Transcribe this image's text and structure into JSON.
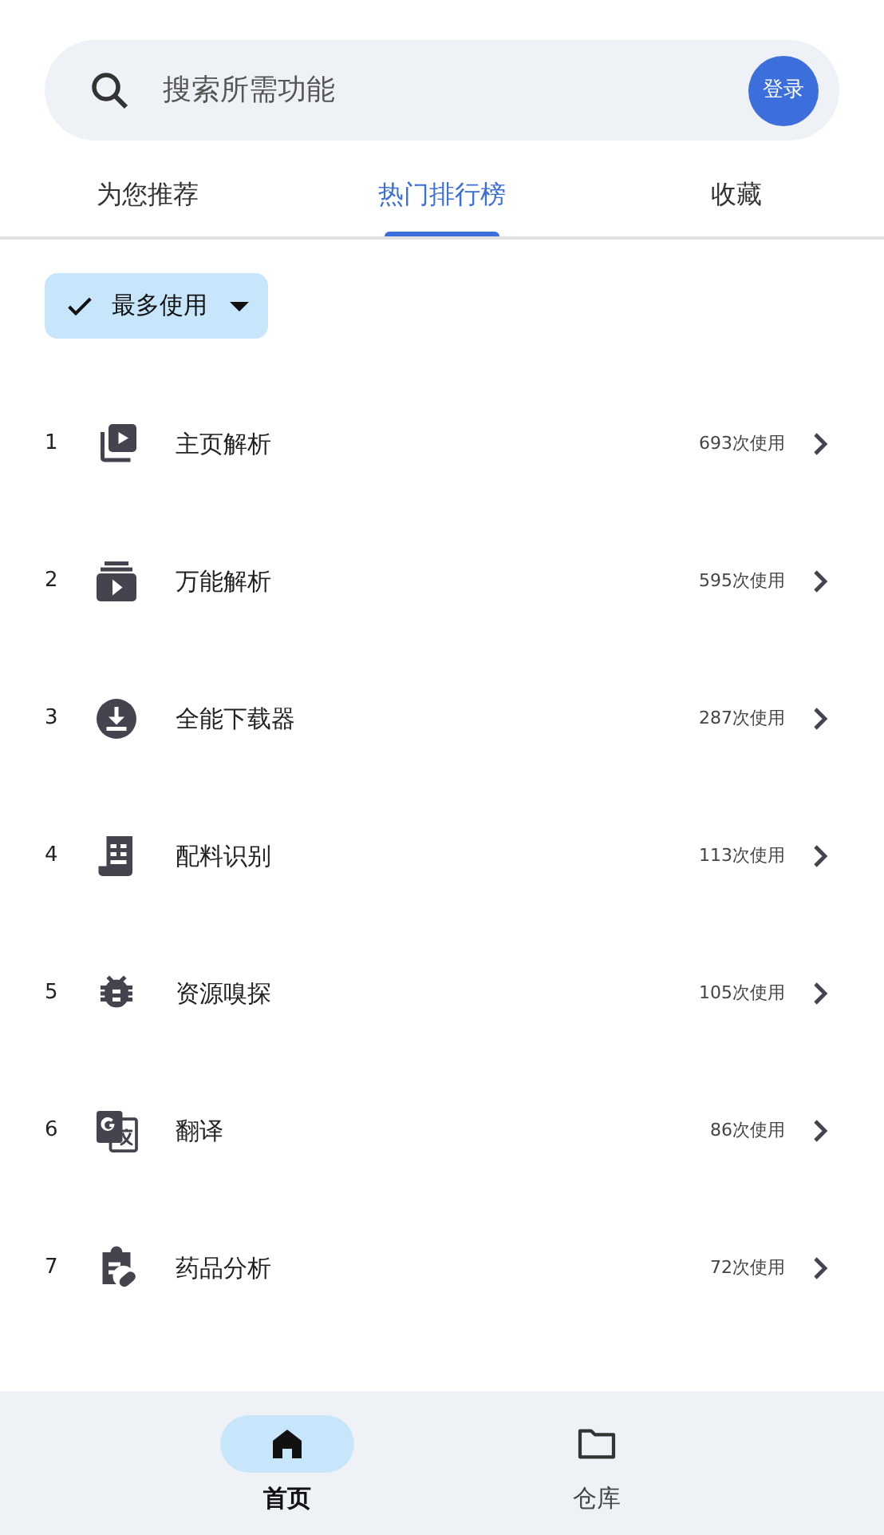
{
  "search": {
    "placeholder": "搜索所需功能",
    "login": "登录"
  },
  "tabs": [
    {
      "label": "为您推荐",
      "selected": false
    },
    {
      "label": "热门排行榜",
      "selected": true
    },
    {
      "label": "收藏",
      "selected": false
    }
  ],
  "filter": {
    "label": "最多使用",
    "checked": true
  },
  "items": [
    {
      "rank": "1",
      "kind": "video-stack",
      "name": "主页解析",
      "uses": "693次使用"
    },
    {
      "rank": "2",
      "kind": "video-box",
      "name": "万能解析",
      "uses": "595次使用"
    },
    {
      "rank": "3",
      "kind": "download",
      "name": "全能下载器",
      "uses": "287次使用"
    },
    {
      "rank": "4",
      "kind": "receipt",
      "name": "配料识别",
      "uses": "113次使用"
    },
    {
      "rank": "5",
      "kind": "bug",
      "name": "资源嗅探",
      "uses": "105次使用"
    },
    {
      "rank": "6",
      "kind": "translate",
      "name": "翻译",
      "uses": "86次使用"
    },
    {
      "rank": "7",
      "kind": "clipboard",
      "name": "药品分析",
      "uses": "72次使用"
    }
  ],
  "nav": [
    {
      "label": "首页",
      "kind": "home",
      "selected": true
    },
    {
      "label": "仓库",
      "kind": "folder",
      "selected": false
    }
  ]
}
